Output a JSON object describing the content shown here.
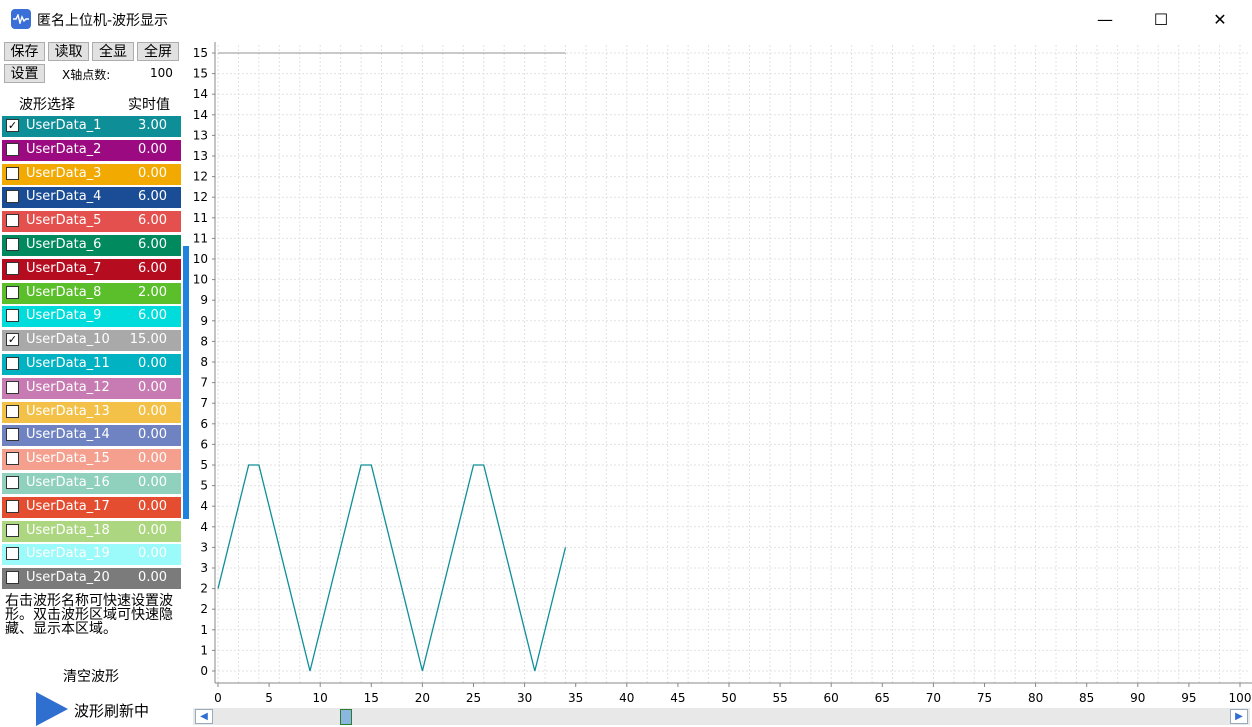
{
  "window": {
    "title": "匿名上位机-波形显示",
    "minimize": "—",
    "maximize": "☐",
    "close": "✕"
  },
  "toolbar": {
    "save": "保存",
    "read": "读取",
    "show_all": "全显",
    "fullscreen": "全屏",
    "settings": "设置",
    "x_points_label": "X轴点数:",
    "x_points_value": "100"
  },
  "list_header": {
    "wave_select": "波形选择",
    "realtime": "实时值"
  },
  "waves": [
    {
      "name": "UserData_1",
      "value": "3.00",
      "color": "#0e8f98",
      "checked": true,
      "text": "#ffffff"
    },
    {
      "name": "UserData_2",
      "value": "0.00",
      "color": "#9b0a80",
      "checked": false,
      "text": "#ffffff"
    },
    {
      "name": "UserData_3",
      "value": "0.00",
      "color": "#f2a900",
      "checked": false,
      "text": "#ffffff"
    },
    {
      "name": "UserData_4",
      "value": "6.00",
      "color": "#1b4d96",
      "checked": false,
      "text": "#ffffff"
    },
    {
      "name": "UserData_5",
      "value": "6.00",
      "color": "#e4504e",
      "checked": false,
      "text": "#ffffff"
    },
    {
      "name": "UserData_6",
      "value": "6.00",
      "color": "#008a5e",
      "checked": false,
      "text": "#ffffff"
    },
    {
      "name": "UserData_7",
      "value": "6.00",
      "color": "#b50d1f",
      "checked": false,
      "text": "#ffffff"
    },
    {
      "name": "UserData_8",
      "value": "2.00",
      "color": "#5abf2a",
      "checked": false,
      "text": "#ffffff"
    },
    {
      "name": "UserData_9",
      "value": "6.00",
      "color": "#00dcdc",
      "checked": false,
      "text": "#ffffff"
    },
    {
      "name": "UserData_10",
      "value": "15.00",
      "color": "#a9a9a9",
      "checked": true,
      "text": "#ffffff"
    },
    {
      "name": "UserData_11",
      "value": "0.00",
      "color": "#00b2c2",
      "checked": false,
      "text": "#ffffff"
    },
    {
      "name": "UserData_12",
      "value": "0.00",
      "color": "#c87bb2",
      "checked": false,
      "text": "#ffffff"
    },
    {
      "name": "UserData_13",
      "value": "0.00",
      "color": "#f3c148",
      "checked": false,
      "text": "#ffffff"
    },
    {
      "name": "UserData_14",
      "value": "0.00",
      "color": "#6f83c2",
      "checked": false,
      "text": "#ffffff"
    },
    {
      "name": "UserData_15",
      "value": "0.00",
      "color": "#f5a08e",
      "checked": false,
      "text": "#ffffff"
    },
    {
      "name": "UserData_16",
      "value": "0.00",
      "color": "#8fd1bd",
      "checked": false,
      "text": "#ffffff"
    },
    {
      "name": "UserData_17",
      "value": "0.00",
      "color": "#e44d2f",
      "checked": false,
      "text": "#ffffff"
    },
    {
      "name": "UserData_18",
      "value": "0.00",
      "color": "#acd67f",
      "checked": false,
      "text": "#ffffff"
    },
    {
      "name": "UserData_19",
      "value": "0.00",
      "color": "#9bfafa",
      "checked": false,
      "text": "#ffffff"
    },
    {
      "name": "UserData_20",
      "value": "0.00",
      "color": "#7b7b7b",
      "checked": false,
      "text": "#ffffff"
    }
  ],
  "hint": "右击波形名称可快速设置波形。双击波形区域可快速隐藏、显示本区域。",
  "clear_button": "清空波形",
  "refresh_status": "波形刷新中",
  "chart_data": {
    "type": "line",
    "xlim": [
      0,
      100
    ],
    "ylim": [
      0,
      15
    ],
    "x_ticks": [
      "0",
      "5",
      "10",
      "15",
      "20",
      "25",
      "30",
      "35",
      "40",
      "45",
      "50",
      "55",
      "60",
      "65",
      "70",
      "75",
      "80",
      "85",
      "90",
      "95",
      "100"
    ],
    "y_ticks": [
      "0",
      "1",
      "1",
      "2",
      "2",
      "3",
      "3",
      "4",
      "4",
      "5",
      "5",
      "6",
      "6",
      "7",
      "7",
      "8",
      "8",
      "9",
      "9",
      "10",
      "10",
      "11",
      "11",
      "12",
      "12",
      "13",
      "13",
      "14",
      "14",
      "15",
      "15"
    ],
    "grid": true,
    "series": [
      {
        "name": "UserData_1",
        "color": "#0e8f98",
        "x": [
          0,
          3,
          4,
          9,
          14,
          15,
          20,
          25,
          26,
          31,
          34
        ],
        "y": [
          2,
          5,
          5,
          0,
          5,
          5,
          0,
          5,
          5,
          0,
          3
        ]
      },
      {
        "name": "UserData_10",
        "color": "#a9a9a9",
        "x": [
          0,
          34
        ],
        "y": [
          15,
          15
        ]
      }
    ]
  }
}
